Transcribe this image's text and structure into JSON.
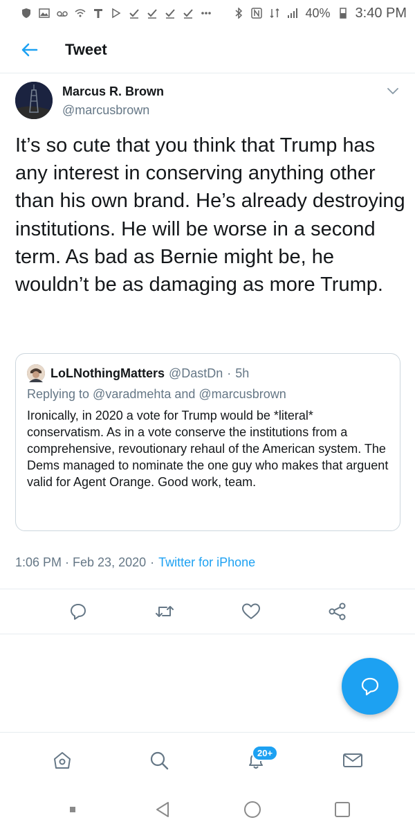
{
  "status_bar": {
    "time": "3:40 PM",
    "battery": "40%",
    "carrier_icon": "t-mobile-icon"
  },
  "header": {
    "title": "Tweet"
  },
  "tweet": {
    "author_name": "Marcus R. Brown",
    "author_handle": "@marcusbrown",
    "text": "It’s so cute that you think that Trump has any interest in conserving anything other than his own brand. He’s already destroying institutions. He will be worse in a second term. As bad as Bernie might be, he wouldn’t be as damaging as more Trump.",
    "timestamp": "1:06 PM · Feb 23, 2020",
    "client_separator": "·",
    "client": "Twitter for iPhone"
  },
  "quote": {
    "name": "LoLNothingMatters",
    "handle": "@DastDn",
    "dot": "·",
    "time": "5h",
    "replying_to": "Replying to @varadmehta and @marcusbrown",
    "text": "Ironically, in 2020 a vote for Trump would be *literal* conservatism. As in a vote conserve the institutions from a comprehensive, revoutionary rehaul of the American system. The Dems managed to nominate the one guy who makes that arguent valid for Agent Orange. Good work, team."
  },
  "bottom_nav": {
    "notifications_badge": "20+"
  },
  "colors": {
    "accent": "#1da1f2",
    "text": "#14171a",
    "secondary_text": "#657786",
    "border": "#ccd6dd"
  }
}
